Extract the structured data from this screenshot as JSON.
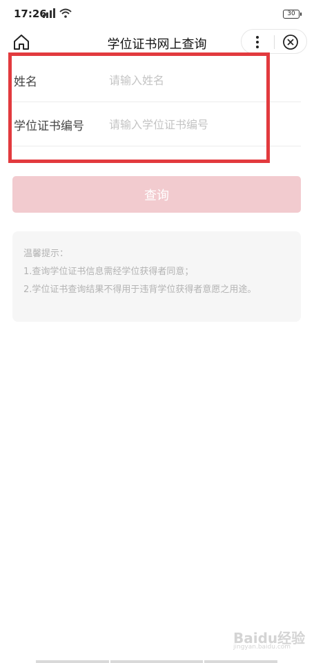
{
  "status_bar": {
    "time": "17:26",
    "battery": "30"
  },
  "nav": {
    "title": "学位证书网上查询"
  },
  "form": {
    "name_label": "姓名",
    "name_placeholder": "请输入姓名",
    "cert_label": "学位证书编号",
    "cert_placeholder": "请输入学位证书编号"
  },
  "query_button": {
    "label": "查询"
  },
  "tips": {
    "heading": "温馨提示：",
    "line1": "1.查询学位证书信息需经学位获得者同意；",
    "line2": "2.学位证书查询结果不得用于违背学位获得者意愿之用途。"
  },
  "watermark": {
    "text": "Baidu经验",
    "sub": "jingyan.baidu.com"
  },
  "colors": {
    "highlight": "#e23a3e",
    "button_bg": "#f2cbcf",
    "tips_bg": "#f6f6f6"
  }
}
